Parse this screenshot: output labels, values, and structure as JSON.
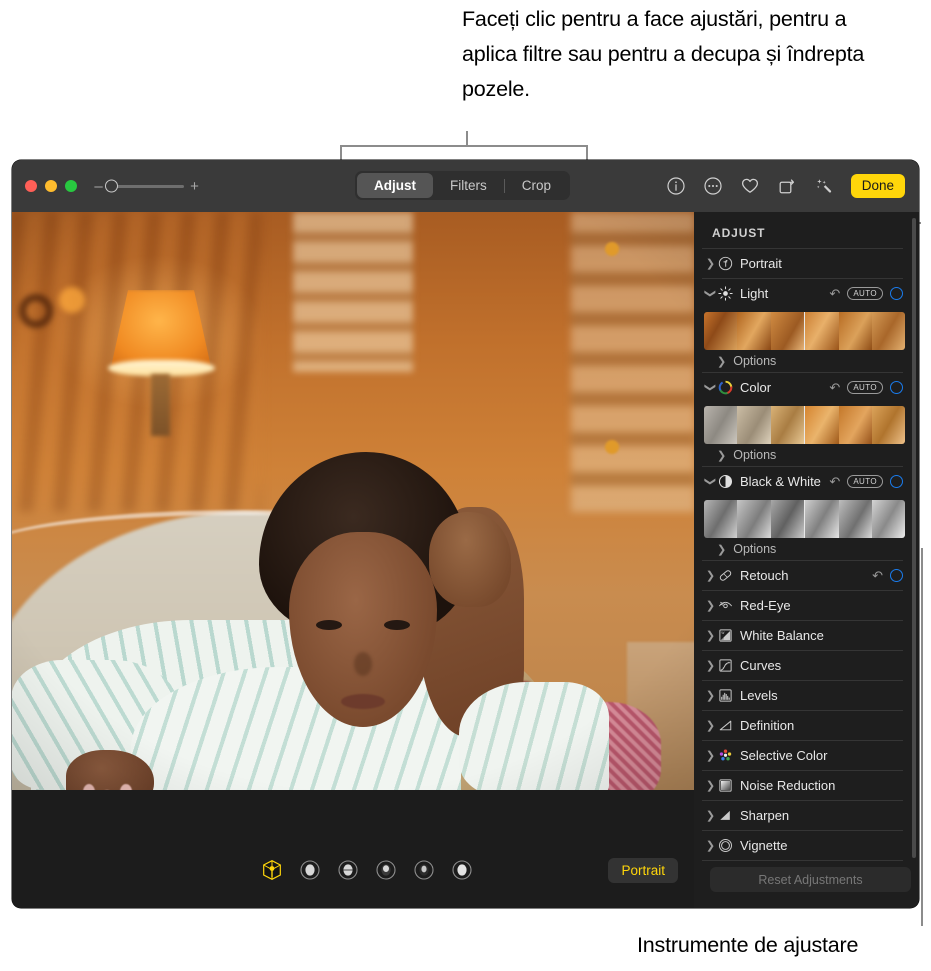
{
  "annotations": {
    "top": "Faceți clic pentru a face ajustări, pentru a aplica filtre sau pentru a decupa și îndrepta pozele.",
    "bottom": "Instrumente de ajustare"
  },
  "titlebar": {
    "traffic_lights": [
      "close",
      "minimize",
      "zoom"
    ],
    "zoom_slider": {
      "minus": "–",
      "plus": "+",
      "value": 0
    },
    "segmented": [
      {
        "label": "Adjust",
        "active": true
      },
      {
        "label": "Filters",
        "active": false
      },
      {
        "label": "Crop",
        "active": false
      }
    ],
    "tools": [
      {
        "name": "info-icon"
      },
      {
        "name": "more-options-icon"
      },
      {
        "name": "favorite-heart-icon"
      },
      {
        "name": "rotate-icon"
      },
      {
        "name": "auto-enhance-icon"
      }
    ],
    "done_label": "Done"
  },
  "canvas": {
    "light_effects": [
      {
        "name": "natural-light-effect",
        "label": "Natural Light",
        "selected": true
      },
      {
        "name": "studio-light-effect",
        "label": "Studio Light",
        "selected": false
      },
      {
        "name": "contour-light-effect",
        "label": "Contour Light",
        "selected": false
      },
      {
        "name": "stage-light-effect",
        "label": "Stage Light",
        "selected": false
      },
      {
        "name": "stage-light-mono-effect",
        "label": "Stage Light Mono",
        "selected": false
      },
      {
        "name": "high-key-light-mono-effect",
        "label": "High-Key Light Mono",
        "selected": false
      }
    ],
    "portrait_badge": "Portrait"
  },
  "sidebar": {
    "title": "ADJUST",
    "options_label": "Options",
    "auto_label": "AUTO",
    "reset_label": "Reset Adjustments",
    "items": [
      {
        "label": "Portrait",
        "icon": "portrait-f-icon",
        "expanded": false,
        "has_revert": false,
        "has_auto": false,
        "has_knob": false,
        "has_strip": false
      },
      {
        "label": "Light",
        "icon": "sun-icon",
        "expanded": true,
        "has_revert": true,
        "has_auto": true,
        "has_knob": true,
        "has_strip": true
      },
      {
        "label": "Color",
        "icon": "color-wheel-icon",
        "expanded": true,
        "has_revert": true,
        "has_auto": true,
        "has_knob": true,
        "has_strip": true
      },
      {
        "label": "Black & White",
        "icon": "contrast-circle-icon",
        "expanded": true,
        "has_revert": true,
        "has_auto": true,
        "has_knob": true,
        "has_strip": true
      },
      {
        "label": "Retouch",
        "icon": "bandage-icon",
        "expanded": false,
        "has_revert": true,
        "has_auto": false,
        "has_knob": true,
        "has_strip": false
      },
      {
        "label": "Red-Eye",
        "icon": "red-eye-icon",
        "expanded": false,
        "has_revert": false,
        "has_auto": false,
        "has_knob": false,
        "has_strip": false
      },
      {
        "label": "White Balance",
        "icon": "white-balance-icon",
        "expanded": false,
        "has_revert": false,
        "has_auto": false,
        "has_knob": false,
        "has_strip": false
      },
      {
        "label": "Curves",
        "icon": "curves-icon",
        "expanded": false,
        "has_revert": false,
        "has_auto": false,
        "has_knob": false,
        "has_strip": false
      },
      {
        "label": "Levels",
        "icon": "levels-icon",
        "expanded": false,
        "has_revert": false,
        "has_auto": false,
        "has_knob": false,
        "has_strip": false
      },
      {
        "label": "Definition",
        "icon": "definition-icon",
        "expanded": false,
        "has_revert": false,
        "has_auto": false,
        "has_knob": false,
        "has_strip": false
      },
      {
        "label": "Selective Color",
        "icon": "selective-color-icon",
        "expanded": false,
        "has_revert": false,
        "has_auto": false,
        "has_knob": false,
        "has_strip": false
      },
      {
        "label": "Noise Reduction",
        "icon": "noise-reduction-icon",
        "expanded": false,
        "has_revert": false,
        "has_auto": false,
        "has_knob": false,
        "has_strip": false
      },
      {
        "label": "Sharpen",
        "icon": "sharpen-icon",
        "expanded": false,
        "has_revert": false,
        "has_auto": false,
        "has_knob": false,
        "has_strip": false
      },
      {
        "label": "Vignette",
        "icon": "vignette-icon",
        "expanded": false,
        "has_revert": false,
        "has_auto": false,
        "has_knob": false,
        "has_strip": false
      }
    ]
  },
  "colors": {
    "accent_yellow": "#ffd60a",
    "knob_blue": "#1a7ced",
    "window_bg": "#1c1c1c",
    "titlebar_bg": "#3a3a3a",
    "sidebar_bg": "#1e1e1e",
    "leader_gray": "#8c8c8c"
  }
}
